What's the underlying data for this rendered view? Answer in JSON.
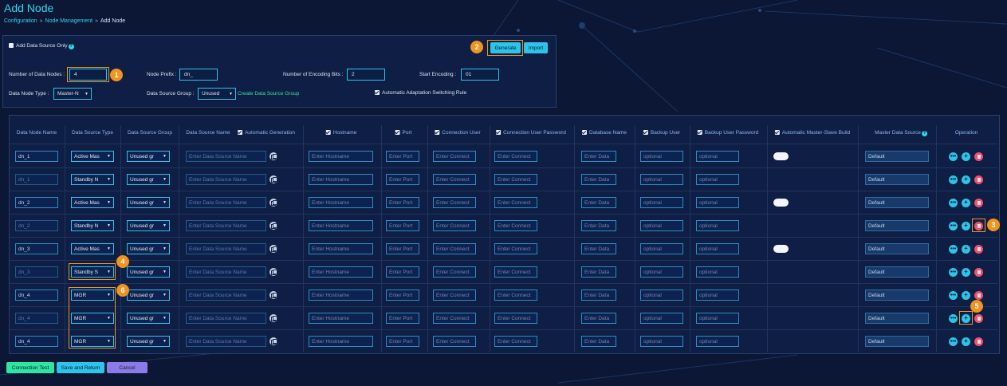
{
  "page": {
    "title": "Add Node",
    "breadcrumb": [
      "Configuration",
      "Node Management",
      "Add Node"
    ],
    "breadcrumb_sep": "»"
  },
  "form": {
    "add_data_source_only": {
      "label": "Add Data Source Only",
      "checked": false
    },
    "generate_label": "Generate",
    "import_label": "Import",
    "num_data_nodes": {
      "label": "Number of Data Nodes :",
      "value": "4"
    },
    "node_prefix": {
      "label": "Node Prefix :",
      "value": "dn_"
    },
    "encoding_bits": {
      "label": "Number of Encoding Bits :",
      "value": "2"
    },
    "start_encoding": {
      "label": "Start Encoding :",
      "value": "01"
    },
    "data_node_type": {
      "label": "Data Node Type :",
      "value": "Master-N"
    },
    "data_source_group": {
      "label": "Data Source Group :",
      "value": "Unused"
    },
    "create_group_link": "Create Data Source Group",
    "auto_switching": {
      "label": "Automatic Adaptation Switching Rule",
      "checked": true
    }
  },
  "table": {
    "headers": {
      "node_name": "Data Node Name",
      "source_type": "Data Source Type",
      "source_group": "Data Source Group",
      "source_name": "Data Source Name",
      "auto_gen": "Automatic Generation",
      "hostname": "Hostname",
      "port": "Port",
      "conn_user": "Connection User",
      "conn_pwd": "Connection User Password",
      "db_name": "Database Name",
      "backup_user": "Backup User",
      "backup_pwd": "Backup User Password",
      "auto_ms": "Automatic Master-Slave Build",
      "master_ds": "Master Data Source",
      "operation": "Operation"
    },
    "placeholders": {
      "source_name": "Enter Data Source Name",
      "hostname": "Enter Hostname",
      "port": "Enter Port",
      "conn_user": "Enter Connect",
      "conn_pwd": "Enter Connect",
      "db_name": "Enter Data",
      "backup_user": "optional",
      "backup_pwd": "optional",
      "master_ds": "Default"
    },
    "rows": [
      {
        "name": "dn_1",
        "type": "Active Mas",
        "group": "Unused gr",
        "toggle": true
      },
      {
        "name": "dn_1",
        "type": "Standby N",
        "group": "Unused gr",
        "toggle": false
      },
      {
        "name": "dn_2",
        "type": "Active Mas",
        "group": "Unused gr",
        "toggle": true
      },
      {
        "name": "dn_2",
        "type": "Standby N",
        "group": "Unused gr",
        "toggle": false
      },
      {
        "name": "dn_3",
        "type": "Active Mas",
        "group": "Unused gr",
        "toggle": true
      },
      {
        "name": "dn_3",
        "type": "Standby S",
        "group": "Unused gr",
        "toggle": false
      },
      {
        "name": "dn_4",
        "type": "MGR",
        "group": "Unused gr",
        "toggle": false
      },
      {
        "name": "dn_4",
        "type": "MGR",
        "group": "Unused gr",
        "toggle": false
      },
      {
        "name": "dn_4",
        "type": "MGR",
        "group": "Unused gr",
        "toggle": false
      }
    ]
  },
  "ops_icons": [
    "more-icon",
    "add-icon",
    "delete-icon"
  ],
  "footer": {
    "connection_test": "Connection Test",
    "save_return": "Save and Return",
    "cancel": "Cancel"
  },
  "callouts": [
    "1",
    "2",
    "3",
    "4",
    "5",
    "6"
  ],
  "colors": {
    "accent": "#2fd6f0",
    "highlight": "#f0941e",
    "delete": "#f0506e",
    "green": "#2ee6a0"
  }
}
